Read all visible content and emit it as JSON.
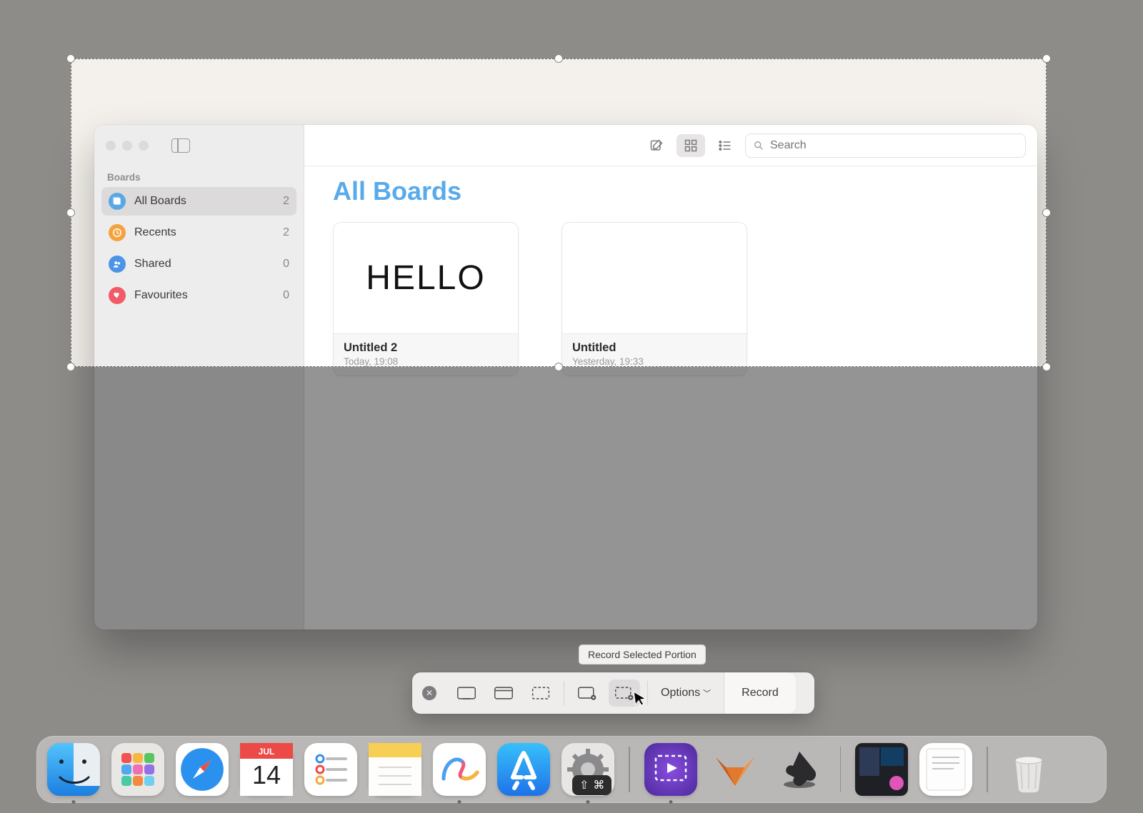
{
  "sidebar": {
    "section": "Boards",
    "items": [
      {
        "label": "All Boards",
        "count": "2",
        "icon": "boards",
        "color": "#5aa7e6",
        "active": true
      },
      {
        "label": "Recents",
        "count": "2",
        "icon": "clock",
        "color": "#f4a33c",
        "active": false
      },
      {
        "label": "Shared",
        "count": "0",
        "icon": "people",
        "color": "#4c94e8",
        "active": false
      },
      {
        "label": "Favourites",
        "count": "0",
        "icon": "heart",
        "color": "#f15a66",
        "active": false
      }
    ]
  },
  "toolbar": {
    "search_placeholder": "Search"
  },
  "main": {
    "title": "All Boards",
    "cards": [
      {
        "preview_text": "HELLO",
        "title": "Untitled 2",
        "subtitle": "Today, 19:08"
      },
      {
        "preview_text": "",
        "title": "Untitled",
        "subtitle": "Yesterday, 19:33"
      }
    ]
  },
  "screenshot_toolbar": {
    "tooltip": "Record Selected Portion",
    "options_label": "Options",
    "record_label": "Record"
  },
  "dock": {
    "calendar_month": "JUL",
    "calendar_day": "14",
    "shortcut_badge": "⇧⌘"
  }
}
